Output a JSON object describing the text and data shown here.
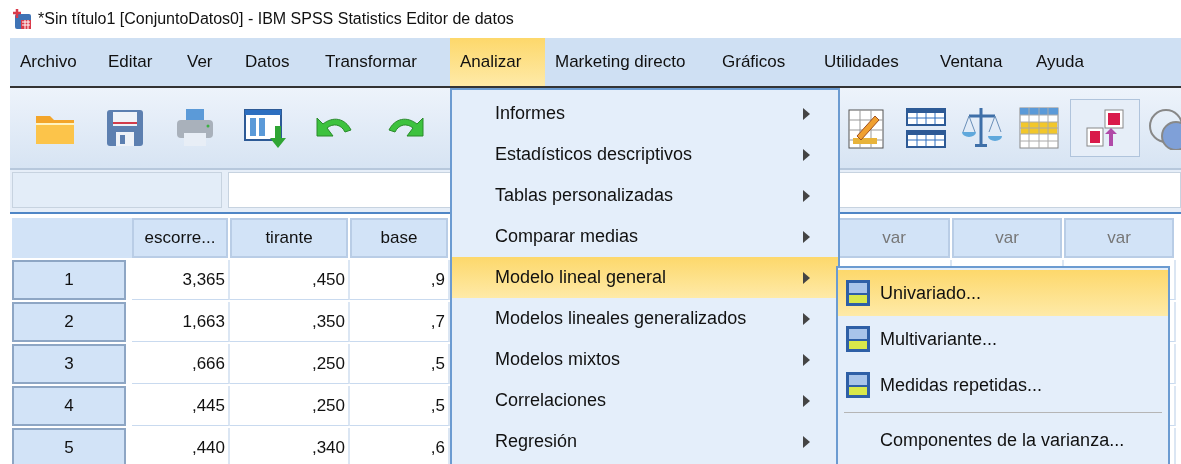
{
  "window": {
    "title": "*Sin título1 [ConjuntoDatos0] - IBM SPSS Statistics Editor de datos"
  },
  "menu_bar": [
    {
      "label": "Archivo",
      "selected": false
    },
    {
      "label": "Editar",
      "selected": false
    },
    {
      "label": "Ver",
      "selected": false
    },
    {
      "label": "Datos",
      "selected": false
    },
    {
      "label": "Transformar",
      "selected": false
    },
    {
      "label": "Analizar",
      "selected": true
    },
    {
      "label": "Marketing directo",
      "selected": false
    },
    {
      "label": "Gráficos",
      "selected": false
    },
    {
      "label": "Utilidades",
      "selected": false
    },
    {
      "label": "Ventana",
      "selected": false
    },
    {
      "label": "Ayuda",
      "selected": false
    }
  ],
  "toolbar": {
    "left": [
      {
        "kind": "open",
        "pressed": false
      },
      {
        "kind": "save",
        "pressed": false
      },
      {
        "kind": "print",
        "pressed": false
      },
      {
        "kind": "recall",
        "pressed": false
      },
      {
        "kind": "undo",
        "pressed": false
      },
      {
        "kind": "redo",
        "pressed": false
      }
    ],
    "right": [
      {
        "kind": "editgrid",
        "pressed": false
      },
      {
        "kind": "split",
        "pressed": false
      },
      {
        "kind": "weight",
        "pressed": false
      },
      {
        "kind": "select",
        "pressed": false
      },
      {
        "kind": "labels",
        "pressed": true
      },
      {
        "kind": "sets",
        "pressed": false
      }
    ]
  },
  "grid": {
    "columns": [
      {
        "label": "escorre..."
      },
      {
        "label": "tirante"
      },
      {
        "label": "base"
      }
    ],
    "trailing_columns": [
      {
        "label": "var"
      },
      {
        "label": "var"
      },
      {
        "label": "var"
      }
    ],
    "rows": [
      {
        "label": "1",
        "cells": [
          "3,365",
          ",450",
          ",9"
        ]
      },
      {
        "label": "2",
        "cells": [
          "1,663",
          ",350",
          ",7"
        ]
      },
      {
        "label": "3",
        "cells": [
          ",666",
          ",250",
          ",5"
        ]
      },
      {
        "label": "4",
        "cells": [
          ",445",
          ",250",
          ",5"
        ]
      },
      {
        "label": "5",
        "cells": [
          ",440",
          ",340",
          ",6"
        ]
      }
    ]
  },
  "analyze_menu": {
    "items": [
      {
        "label": "Informes",
        "selected": false,
        "submenu": true
      },
      {
        "label": "Estadísticos descriptivos",
        "selected": false,
        "submenu": true
      },
      {
        "label": "Tablas personalizadas",
        "selected": false,
        "submenu": true
      },
      {
        "label": "Comparar medias",
        "selected": false,
        "submenu": true
      },
      {
        "label": "Modelo lineal general",
        "selected": true,
        "submenu": true
      },
      {
        "label": "Modelos lineales generalizados",
        "selected": false,
        "submenu": true
      },
      {
        "label": "Modelos mixtos",
        "selected": false,
        "submenu": true
      },
      {
        "label": "Correlaciones",
        "selected": false,
        "submenu": true
      },
      {
        "label": "Regresión",
        "selected": false,
        "submenu": true
      }
    ]
  },
  "glm_submenu": {
    "items": [
      {
        "kind": "glm",
        "label": "Univariado...",
        "selected": true
      },
      {
        "kind": "glm",
        "label": "Multivariante...",
        "selected": false
      },
      {
        "kind": "glm",
        "label": "Medidas repetidas...",
        "selected": false
      },
      {
        "kind": "separator"
      },
      {
        "kind": "plain",
        "label": "Componentes de la varianza...",
        "selected": false
      }
    ]
  }
}
